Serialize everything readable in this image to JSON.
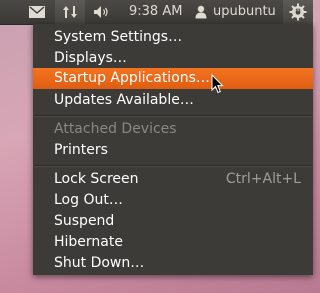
{
  "panel": {
    "time": "9:38 AM",
    "user": "upubuntu",
    "icons": [
      "envelope-icon",
      "network-arrows-icon",
      "volume-icon",
      "user-icon",
      "power-gear-icon"
    ]
  },
  "menu": {
    "items": [
      {
        "label": "System Settings…"
      },
      {
        "label": "Displays…"
      },
      {
        "label": "Startup Applications…",
        "highlighted": true
      },
      {
        "label": "Updates Available…"
      },
      {
        "label": "Attached Devices",
        "disabled": true
      },
      {
        "label": "Printers"
      },
      {
        "label": "Lock Screen",
        "accel": "Ctrl+Alt+L"
      },
      {
        "label": "Log Out…"
      },
      {
        "label": "Suspend"
      },
      {
        "label": "Hibernate"
      },
      {
        "label": "Shut Down…"
      }
    ]
  },
  "colors": {
    "panel_bg": "#3c3b37",
    "menu_bg": "#3c3b37",
    "highlight": "#f07017",
    "text": "#ffffff",
    "disabled_text": "#8b8881"
  }
}
